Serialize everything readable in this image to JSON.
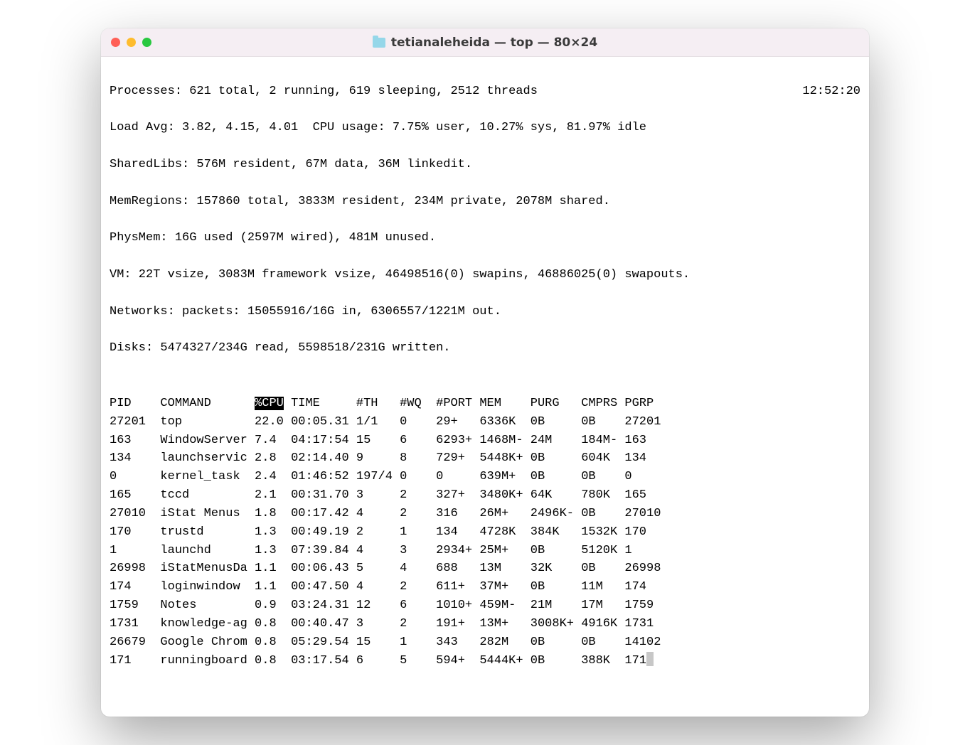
{
  "window": {
    "title": "tetianaleheida — top — 80×24"
  },
  "summary": {
    "line1_left": "Processes: 621 total, 2 running, 619 sleeping, 2512 threads",
    "line1_right": "12:52:20",
    "line2": "Load Avg: 3.82, 4.15, 4.01  CPU usage: 7.75% user, 10.27% sys, 81.97% idle",
    "line3": "SharedLibs: 576M resident, 67M data, 36M linkedit.",
    "line4": "MemRegions: 157860 total, 3833M resident, 234M private, 2078M shared.",
    "line5": "PhysMem: 16G used (2597M wired), 481M unused.",
    "line6": "VM: 22T vsize, 3083M framework vsize, 46498516(0) swapins, 46886025(0) swapouts.",
    "line7": "Networks: packets: 15055916/16G in, 6306557/1221M out.",
    "line8": "Disks: 5474327/234G read, 5598518/231G written."
  },
  "columns": {
    "pid": "PID",
    "command": "COMMAND",
    "cpu": "%CPU",
    "time": "TIME",
    "th": "#TH",
    "wq": "#WQ",
    "port": "#PORT",
    "mem": "MEM",
    "purg": "PURG",
    "cmprs": "CMPRS",
    "pgrp": "PGRP"
  },
  "processes": [
    {
      "pid": "27201",
      "command": "top",
      "cpu": "22.0",
      "time": "00:05.31",
      "th": "1/1",
      "wq": "0",
      "port": "29+",
      "mem": "6336K",
      "purg": "0B",
      "cmprs": "0B",
      "pgrp": "27201"
    },
    {
      "pid": "163",
      "command": "WindowServer",
      "cpu": "7.4",
      "time": "04:17:54",
      "th": "15",
      "wq": "6",
      "port": "6293+",
      "mem": "1468M-",
      "purg": "24M",
      "cmprs": "184M-",
      "pgrp": "163"
    },
    {
      "pid": "134",
      "command": "launchservic",
      "cpu": "2.8",
      "time": "02:14.40",
      "th": "9",
      "wq": "8",
      "port": "729+",
      "mem": "5448K+",
      "purg": "0B",
      "cmprs": "604K",
      "pgrp": "134"
    },
    {
      "pid": "0",
      "command": "kernel_task",
      "cpu": "2.4",
      "time": "01:46:52",
      "th": "197/4",
      "wq": "0",
      "port": "0",
      "mem": "639M+",
      "purg": "0B",
      "cmprs": "0B",
      "pgrp": "0"
    },
    {
      "pid": "165",
      "command": "tccd",
      "cpu": "2.1",
      "time": "00:31.70",
      "th": "3",
      "wq": "2",
      "port": "327+",
      "mem": "3480K+",
      "purg": "64K",
      "cmprs": "780K",
      "pgrp": "165"
    },
    {
      "pid": "27010",
      "command": "iStat Menus",
      "cpu": "1.8",
      "time": "00:17.42",
      "th": "4",
      "wq": "2",
      "port": "316",
      "mem": "26M+",
      "purg": "2496K-",
      "cmprs": "0B",
      "pgrp": "27010"
    },
    {
      "pid": "170",
      "command": "trustd",
      "cpu": "1.3",
      "time": "00:49.19",
      "th": "2",
      "wq": "1",
      "port": "134",
      "mem": "4728K",
      "purg": "384K",
      "cmprs": "1532K",
      "pgrp": "170"
    },
    {
      "pid": "1",
      "command": "launchd",
      "cpu": "1.3",
      "time": "07:39.84",
      "th": "4",
      "wq": "3",
      "port": "2934+",
      "mem": "25M+",
      "purg": "0B",
      "cmprs": "5120K",
      "pgrp": "1"
    },
    {
      "pid": "26998",
      "command": "iStatMenusDa",
      "cpu": "1.1",
      "time": "00:06.43",
      "th": "5",
      "wq": "4",
      "port": "688",
      "mem": "13M",
      "purg": "32K",
      "cmprs": "0B",
      "pgrp": "26998"
    },
    {
      "pid": "174",
      "command": "loginwindow",
      "cpu": "1.1",
      "time": "00:47.50",
      "th": "4",
      "wq": "2",
      "port": "611+",
      "mem": "37M+",
      "purg": "0B",
      "cmprs": "11M",
      "pgrp": "174"
    },
    {
      "pid": "1759",
      "command": "Notes",
      "cpu": "0.9",
      "time": "03:24.31",
      "th": "12",
      "wq": "6",
      "port": "1010+",
      "mem": "459M-",
      "purg": "21M",
      "cmprs": "17M",
      "pgrp": "1759"
    },
    {
      "pid": "1731",
      "command": "knowledge-ag",
      "cpu": "0.8",
      "time": "00:40.47",
      "th": "3",
      "wq": "2",
      "port": "191+",
      "mem": "13M+",
      "purg": "3008K+",
      "cmprs": "4916K",
      "pgrp": "1731"
    },
    {
      "pid": "26679",
      "command": "Google Chrom",
      "cpu": "0.8",
      "time": "05:29.54",
      "th": "15",
      "wq": "1",
      "port": "343",
      "mem": "282M",
      "purg": "0B",
      "cmprs": "0B",
      "pgrp": "14102"
    },
    {
      "pid": "171",
      "command": "runningboard",
      "cpu": "0.8",
      "time": "03:17.54",
      "th": "6",
      "wq": "5",
      "port": "594+",
      "mem": "5444K+",
      "purg": "0B",
      "cmprs": "388K",
      "pgrp": "171"
    }
  ]
}
